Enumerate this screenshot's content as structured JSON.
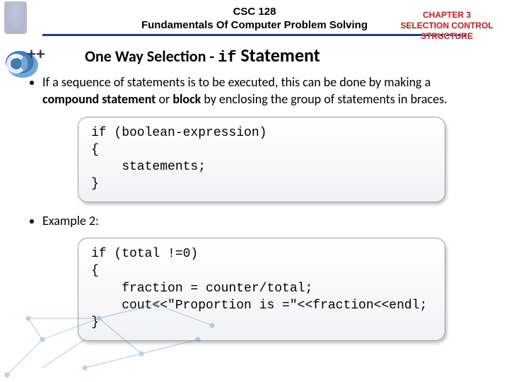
{
  "header": {
    "course_code": "CSC 128",
    "course_title": "Fundamentals Of Computer Problem Solving"
  },
  "chapter": {
    "line1": "CHAPTER 3",
    "line2": "SELECTION CONTROL",
    "line3": "STRUCTURE"
  },
  "section": {
    "prefix": "One Way Selection - ",
    "keyword": "if",
    "suffix": " Statement"
  },
  "bullets": {
    "b1_part1": "If a sequence of statements is to be executed, this can be done by making a ",
    "b1_bold1": "compound statement",
    "b1_mid": " or ",
    "b1_bold2": "block",
    "b1_part2": " by enclosing the group of statements in braces.",
    "b2": "Example 2:"
  },
  "code1": "if (boolean-expression)\n{\n    statements;\n}",
  "code2": "if (total !=0)\n{\n    fraction = counter/total;\n    cout<<\"Proportion is =\"<<fraction<<endl;\n}"
}
